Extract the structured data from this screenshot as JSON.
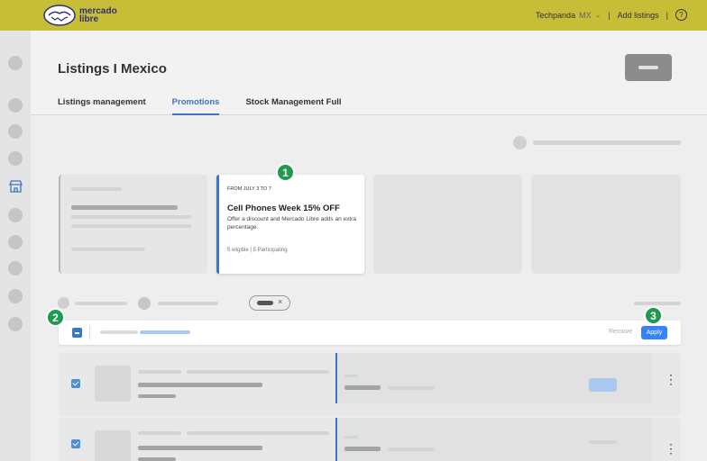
{
  "header": {
    "logo_line1": "mercado",
    "logo_line2": "libre",
    "user": "Techpanda",
    "country": "MX",
    "add_listings": "Add listings",
    "help_glyph": "?"
  },
  "page": {
    "title": "Listings I Mexico",
    "tabs": [
      {
        "label": "Listings management"
      },
      {
        "label": "Promotions"
      },
      {
        "label": "Stock Management Full"
      }
    ]
  },
  "promo_card": {
    "date": "FROM JULY 3 TO 7",
    "title": "Cell Phones Week 15% OFF",
    "description": "Offer a discount and Mercado Libre adds an extra percentage.",
    "stats": "5 eligible | 5 Participating"
  },
  "bulk_bar": {
    "remove_label": "Remove",
    "apply_label": "Apply"
  },
  "markers": [
    "1",
    "2",
    "3"
  ],
  "filter_chip": {
    "close_glyph": "×"
  },
  "rows": [
    {
      "checked": true,
      "menu": "⋮"
    },
    {
      "checked": true,
      "menu": "⋮"
    }
  ],
  "colors": {
    "header_bg": "#c7bd37",
    "accent_blue": "#3483fa",
    "tab_active": "#3b77c2",
    "marker_green": "#1f9a4f"
  },
  "icons": [
    "mercadolibre-logo-icon",
    "chevron-down-icon",
    "help-icon",
    "store-icon",
    "close-icon",
    "kebab-menu-icon",
    "checkbox-icon"
  ]
}
